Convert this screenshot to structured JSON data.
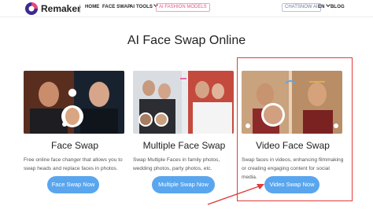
{
  "header": {
    "brand": "Remaker",
    "nav": [
      "HOME",
      "FACE SWAP",
      "AI TOOLS"
    ],
    "fashion": "AI FASHION MODELS",
    "chatsnow": "CHATSNOW AI",
    "lang": "EN",
    "blog": "BLOG"
  },
  "page": {
    "title": "AI Face Swap Online"
  },
  "cards": [
    {
      "title": "Face Swap",
      "desc": "Free online face changer that allows you to swap heads and replace faces in photos.",
      "button": "Face Swap Now"
    },
    {
      "title": "Multiple Face Swap",
      "desc": "Swap Multiple Faces in family photos, wedding photos, party photos, etc.",
      "button": "Multiple Swap Now"
    },
    {
      "title": "Video Face Swap",
      "desc": "Swap faces in videos, enhancing filmmaking or creating engaging content for social media.",
      "button": "Video Swap Now"
    }
  ],
  "colors": {
    "accent": "#5aa6ee",
    "highlight": "#e23b3b",
    "fashion": "#e0577f"
  }
}
